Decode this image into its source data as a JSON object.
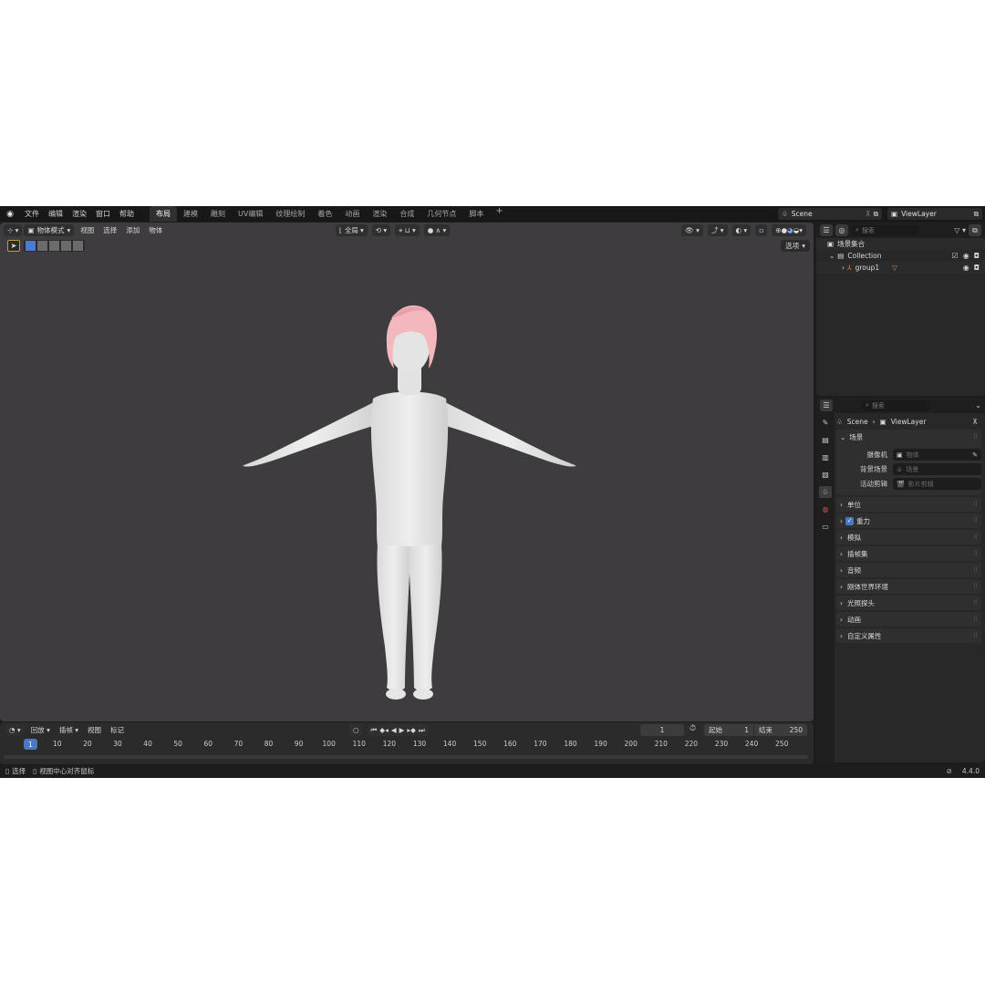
{
  "topbar": {
    "menu": [
      "文件",
      "编辑",
      "渲染",
      "窗口",
      "帮助"
    ],
    "workspaces": [
      "布局",
      "建模",
      "雕刻",
      "UV编辑",
      "纹理绘制",
      "着色",
      "动画",
      "渲染",
      "合成",
      "几何节点",
      "脚本"
    ],
    "active_workspace": "布局",
    "scene_name": "Scene",
    "view_layer": "ViewLayer"
  },
  "viewport": {
    "mode": "物体模式",
    "menus": [
      "视图",
      "选择",
      "添加",
      "物体"
    ],
    "transform_orientation": "全局",
    "options_label": "选项"
  },
  "outliner": {
    "search_placeholder": "搜索",
    "rows": [
      {
        "label": "场景集合"
      },
      {
        "label": "Collection"
      },
      {
        "label": "group1"
      }
    ]
  },
  "properties": {
    "search_placeholder": "搜索",
    "breadcrumb": {
      "scene": "Scene",
      "view_layer": "ViewLayer"
    },
    "scene_panel": {
      "title": "场景",
      "rows": [
        {
          "label": "摄像机",
          "placeholder": "物体"
        },
        {
          "label": "背景场景",
          "placeholder": "场景"
        },
        {
          "label": "活动剪辑",
          "placeholder": "影片剪辑"
        }
      ]
    },
    "panels": [
      "单位",
      "重力",
      "模拟",
      "插帧集",
      "音频",
      "刚体世界环境",
      "光照探头",
      "动画",
      "自定义属性"
    ]
  },
  "timeline": {
    "menus": [
      "回放",
      "插帧",
      "视图",
      "标记"
    ],
    "current_frame": "1",
    "start_label": "起始",
    "start": "1",
    "end_label": "结束",
    "end": "250",
    "ticks": [
      "10",
      "20",
      "30",
      "40",
      "50",
      "60",
      "70",
      "80",
      "90",
      "100",
      "110",
      "120",
      "130",
      "140",
      "150",
      "160",
      "170",
      "180",
      "190",
      "200",
      "210",
      "220",
      "230",
      "240",
      "250"
    ]
  },
  "statusbar": {
    "select": "选择",
    "center_view": "视图中心对齐鼠标",
    "version": "4.4.0"
  }
}
